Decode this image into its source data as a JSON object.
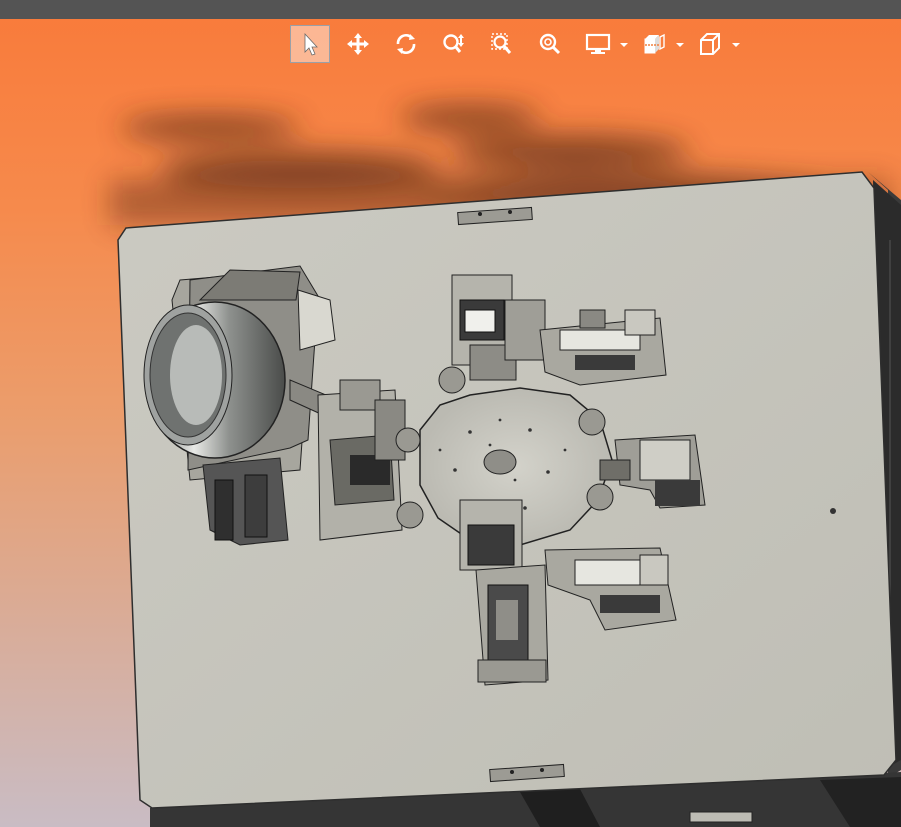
{
  "toolbar": {
    "buttons": [
      {
        "name": "select-tool-button",
        "icon": "arrow-pointer-icon",
        "active": true
      },
      {
        "name": "pan-tool-button",
        "icon": "move-arrows-icon",
        "active": false
      },
      {
        "name": "rotate-tool-button",
        "icon": "rotate-icon",
        "active": false
      },
      {
        "name": "zoom-tool-button",
        "icon": "zoom-updown-icon",
        "active": false
      },
      {
        "name": "zoom-window-button",
        "icon": "zoom-box-icon",
        "active": false
      },
      {
        "name": "zoom-fit-button",
        "icon": "zoom-fit-icon",
        "active": false
      },
      {
        "name": "display-mode-dropdown",
        "icon": "monitor-icon",
        "active": false
      },
      {
        "name": "section-view-dropdown",
        "icon": "section-box-icon",
        "active": false
      },
      {
        "name": "view-orientation-dropdown",
        "icon": "cube-icon",
        "active": false
      }
    ]
  },
  "colors": {
    "background_top": "#f97a3a",
    "background_bottom": "#c9bcc4",
    "plate": "#c7c6bd",
    "part_dark": "#3c3c3c",
    "toolbar_icon": "#ffffff"
  },
  "scene": {
    "model": "rotary-indexing-assembly-plate"
  }
}
